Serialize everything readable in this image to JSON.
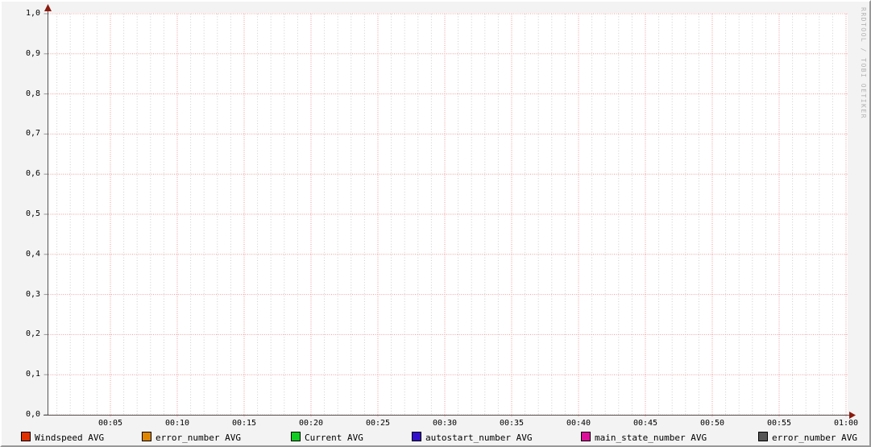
{
  "watermark": "RRDTOOL / TOBI OETIKER",
  "colors": {
    "background": "#F3F3F3",
    "plot_background": "#FFFFFF",
    "major_grid": "#EE9999",
    "minor_grid": "#CCCCCC",
    "axis": "#555555",
    "arrow": "#8B1A0F",
    "tick": "#999999",
    "watermark_text": "#B3B3B3"
  },
  "chart_data": {
    "type": "line",
    "title": "",
    "xlabel": "",
    "ylabel": "",
    "ylim": [
      0.0,
      1.0
    ],
    "xlim_minutes": [
      0,
      60
    ],
    "grid": "on",
    "legend_position": "bottom",
    "y_ticks": [
      "1,0",
      "0,9",
      "0,8",
      "0,7",
      "0,6",
      "0,5",
      "0,4",
      "0,3",
      "0,2",
      "0,1",
      "0,0"
    ],
    "x_ticks": [
      "00:05",
      "00:10",
      "00:15",
      "00:20",
      "00:25",
      "00:30",
      "00:35",
      "00:40",
      "00:45",
      "00:50",
      "00:55",
      "01:00"
    ],
    "x_minor_interval_minutes": 1,
    "x_major_interval_minutes": 5,
    "y_major_interval": 0.1,
    "series": [
      {
        "name": "Windspeed AVG",
        "color": "#E03100",
        "values": []
      },
      {
        "name": "error_number AVG",
        "color": "#DF8600",
        "values": []
      },
      {
        "name": "Current AVG",
        "color": "#11CC22",
        "values": []
      },
      {
        "name": "autostart_number AVG",
        "color": "#3311CC",
        "values": []
      },
      {
        "name": "main_state_number AVG",
        "color": "#DD0F9A",
        "values": []
      },
      {
        "name": "error_number AVG",
        "color": "#555555",
        "values": []
      }
    ],
    "note": "no data plotted - empty graph"
  },
  "legend": [
    {
      "label": "Windspeed AVG",
      "color": "#E03100"
    },
    {
      "label": "error_number AVG",
      "color": "#DF8600"
    },
    {
      "label": "Current AVG",
      "color": "#11CC22"
    },
    {
      "label": "autostart_number AVG",
      "color": "#3311CC"
    },
    {
      "label": "main_state_number AVG",
      "color": "#DD0F9A"
    },
    {
      "label": "error_number AVG",
      "color": "#555555"
    }
  ]
}
